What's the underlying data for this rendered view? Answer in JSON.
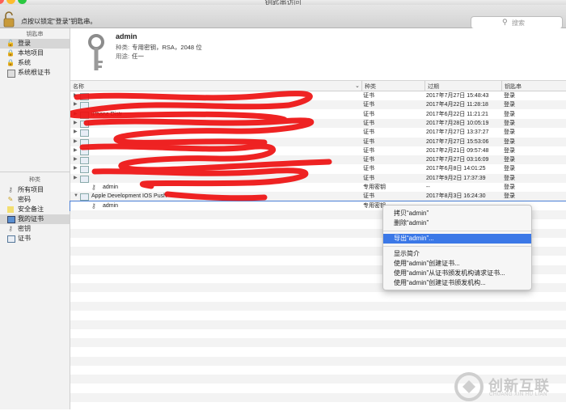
{
  "window": {
    "title": "钥匙串访问"
  },
  "toolbar": {
    "lock_hint": "点按以锁定“登录”钥匙串。",
    "search_placeholder": "搜索"
  },
  "sidebar": {
    "keychains_header": "钥匙串",
    "keychains": [
      {
        "label": "登录",
        "icon": "lock-open-icon",
        "selected": true
      },
      {
        "label": "本地项目",
        "icon": "lock-icon"
      },
      {
        "label": "系统",
        "icon": "lock-icon"
      },
      {
        "label": "系统根证书",
        "icon": "cabinet-icon"
      }
    ],
    "categories_header": "种类",
    "categories": [
      {
        "label": "所有项目",
        "icon": "keys-icon"
      },
      {
        "label": "密码",
        "icon": "pencil-icon"
      },
      {
        "label": "安全备注",
        "icon": "note-icon"
      },
      {
        "label": "我的证书",
        "icon": "my-certificates-icon",
        "selected": true
      },
      {
        "label": "密钥",
        "icon": "key-icon"
      },
      {
        "label": "证书",
        "icon": "certificate-icon"
      }
    ]
  },
  "info": {
    "name": "admin",
    "kind_label": "种类:",
    "kind_value": "专用密钥，RSA，2048 位",
    "use_label": "用途:",
    "use_value": "任一"
  },
  "table": {
    "columns": [
      "名称",
      "种类",
      "过期",
      "钥匙串"
    ],
    "rows": [
      {
        "name": "",
        "kind": "证书",
        "expires": "2017年7月27日 15:48:43",
        "keychain": "登录",
        "indent": 0
      },
      {
        "name": "",
        "kind": "证书",
        "expires": "2017年4月22日 11:28:18",
        "keychain": "登录",
        "indent": 0
      },
      {
        "name": "iPhone Distr",
        "kind": "证书",
        "expires": "2017年6月22日 11:21:21",
        "keychain": "登录",
        "indent": 0
      },
      {
        "name": "",
        "kind": "证书",
        "expires": "2017年7月28日 10:05:19",
        "keychain": "登录",
        "indent": 0
      },
      {
        "name": "",
        "kind": "证书",
        "expires": "2017年7月27日 13:37:27",
        "keychain": "登录",
        "indent": 0
      },
      {
        "name": "",
        "kind": "证书",
        "expires": "2017年7月27日 15:53:06",
        "keychain": "登录",
        "indent": 0
      },
      {
        "name": "",
        "kind": "证书",
        "expires": "2017年2月21日 09:57:48",
        "keychain": "登录",
        "indent": 0
      },
      {
        "name": "",
        "kind": "证书",
        "expires": "2017年7月27日 03:16:09",
        "keychain": "登录",
        "indent": 0
      },
      {
        "name": "",
        "kind": "证书",
        "expires": "2017年6月8日 14:01:25",
        "keychain": "登录",
        "indent": 0
      },
      {
        "name": "",
        "kind": "证书",
        "expires": "2017年9月2日 17:37:39",
        "keychain": "登录",
        "indent": 0
      },
      {
        "name": "admin",
        "kind": "专用密钥",
        "expires": "--",
        "keychain": "登录",
        "indent": 1
      },
      {
        "name": "Apple Development IOS Push",
        "kind": "证书",
        "expires": "2017年8月3日 16:24:30",
        "keychain": "登录",
        "indent": 0
      },
      {
        "name": "admin",
        "kind": "专用密钥",
        "expires": "",
        "keychain": "",
        "indent": 1
      }
    ]
  },
  "context_menu": {
    "items": [
      "拷贝“admin”",
      "删除“admin”",
      "导出“admin”...",
      "显示简介",
      "使用“admin”创建证书...",
      "使用“admin”从证书颁发机构请求证书...",
      "使用“admin”创建证书颁发机构..."
    ],
    "highlighted": 2
  },
  "watermark": {
    "brand": "创新互联",
    "sub": "CHUANG XIN HU LIAN"
  },
  "colors": {
    "selection": "#3b78e7",
    "redaction": "#ee1111",
    "sidebar": "#f2f2f2"
  }
}
